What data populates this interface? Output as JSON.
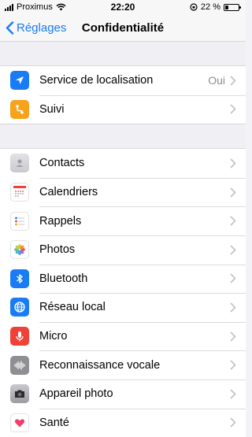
{
  "status": {
    "carrier": "Proximus",
    "time": "22:20",
    "battery": "22 %",
    "battery_level": 0.22
  },
  "nav": {
    "back_label": "Réglages",
    "title": "Confidentialité"
  },
  "group1": [
    {
      "label": "Service de localisation",
      "value": "Oui",
      "icon": "location-arrow-icon",
      "color": "#1a7cf5"
    },
    {
      "label": "Suivi",
      "value": "",
      "icon": "tracking-icon",
      "color": "#f7a21b"
    }
  ],
  "group2": [
    {
      "label": "Contacts",
      "icon": "contacts-icon",
      "color": "#d9d9de"
    },
    {
      "label": "Calendriers",
      "icon": "calendar-icon",
      "color": "#ffffff"
    },
    {
      "label": "Rappels",
      "icon": "reminders-icon",
      "color": "#ffffff"
    },
    {
      "label": "Photos",
      "icon": "photos-icon",
      "color": "#ffffff"
    },
    {
      "label": "Bluetooth",
      "icon": "bluetooth-icon",
      "color": "#1a7cf5"
    },
    {
      "label": "Réseau local",
      "icon": "local-network-icon",
      "color": "#1a7cf5"
    },
    {
      "label": "Micro",
      "icon": "microphone-icon",
      "color": "#ee4238"
    },
    {
      "label": "Reconnaissance vocale",
      "icon": "speech-recognition-icon",
      "color": "#8e8e93"
    },
    {
      "label": "Appareil photo",
      "icon": "camera-icon",
      "color": "#8e8e93"
    },
    {
      "label": "Santé",
      "icon": "health-icon",
      "color": "#ffffff"
    }
  ]
}
